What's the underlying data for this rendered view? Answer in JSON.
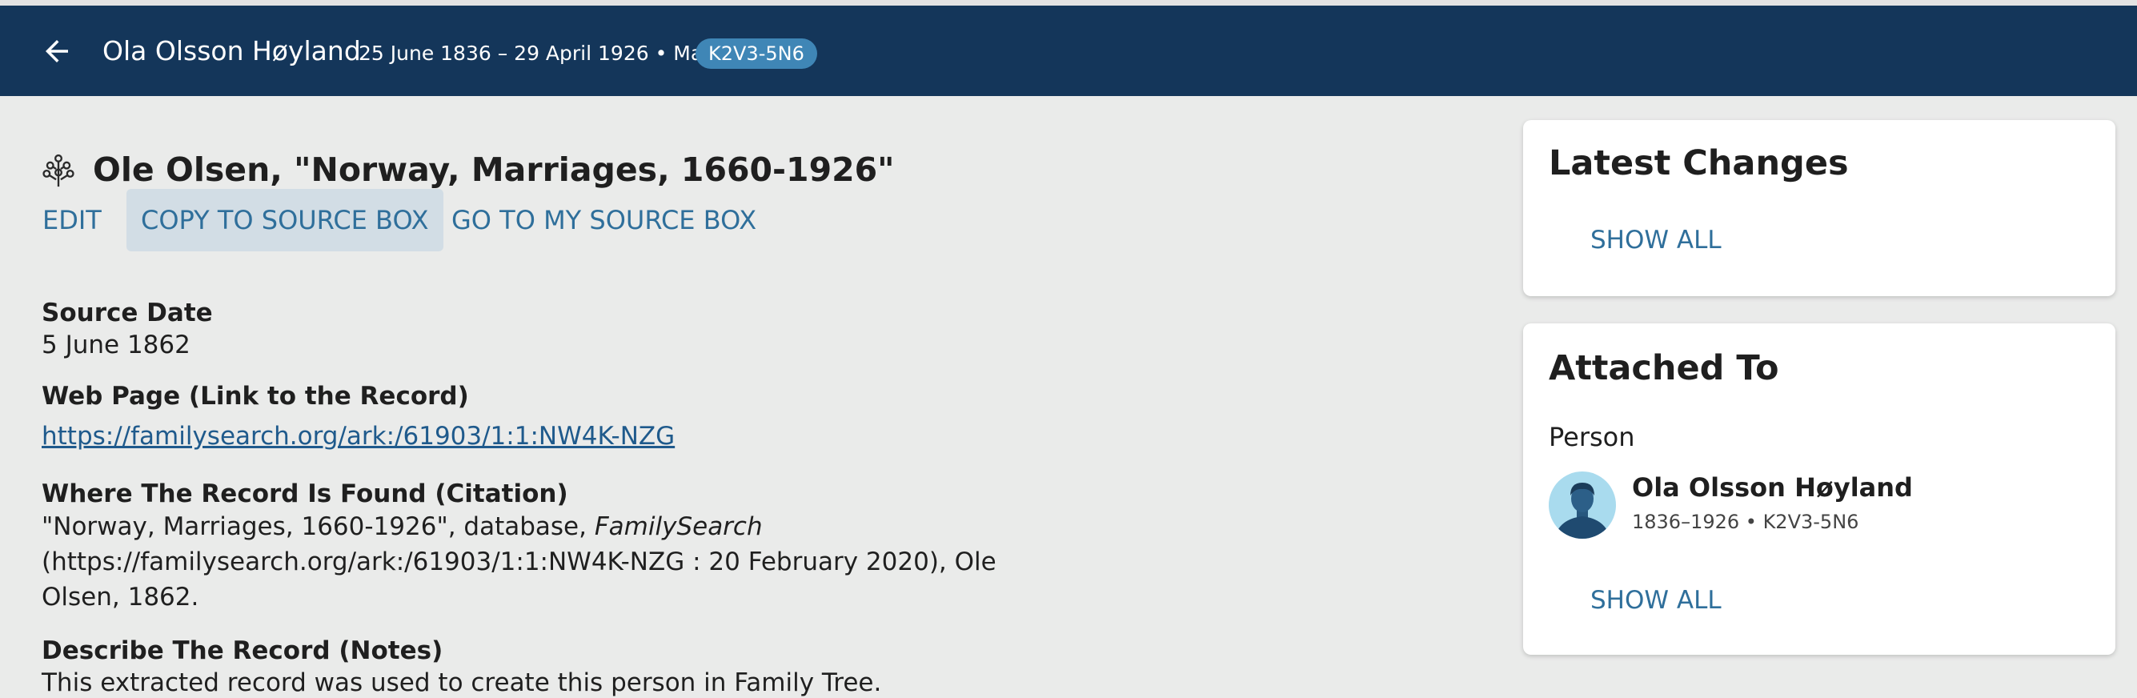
{
  "header": {
    "back_icon": "arrow-left-icon",
    "person_name": "Ola Olsson Høyland",
    "dates_gender": "25 June 1836 – 29 April 1926 • Male",
    "person_id": "K2V3-5N6"
  },
  "source": {
    "tree_icon": "family-tree-icon",
    "title": "Ole Olsen, \"Norway, Marriages, 1660-1926\"",
    "actions": {
      "edit": "EDIT",
      "copy": "COPY TO SOURCE BOX",
      "go": "GO TO MY SOURCE BOX"
    },
    "fields": {
      "date_label": "Source Date",
      "date_value": "5 June 1862",
      "web_label": "Web Page (Link to the Record)",
      "web_value": "https://familysearch.org/ark:/61903/1:1:NW4K-NZG",
      "citation_label": "Where The Record Is Found (Citation)",
      "citation_pre": "\"Norway, Marriages, 1660-1926\", database, ",
      "citation_italic": "FamilySearch",
      "citation_post": " (https://familysearch.org/ark:/61903/1:1:NW4K-NZG : 20 February 2020), Ole Olsen, 1862.",
      "notes_label": "Describe The Record (Notes)",
      "notes_value": "This extracted record was used to create this person in Family Tree."
    }
  },
  "sidebar": {
    "latest_changes": {
      "title": "Latest Changes",
      "show_all": "SHOW ALL"
    },
    "attached_to": {
      "title": "Attached To",
      "section": "Person",
      "avatar_icon": "male-avatar-icon",
      "person_name": "Ola Olsson Høyland",
      "person_meta": "1836–1926 • K2V3-5N6",
      "show_all": "SHOW ALL"
    }
  },
  "colors": {
    "header_bg": "#14365a",
    "badge_bg": "#3f86b6",
    "link": "#2f6f9b",
    "page_bg": "#eaebea",
    "copy_button_bg": "#d2dde5"
  }
}
